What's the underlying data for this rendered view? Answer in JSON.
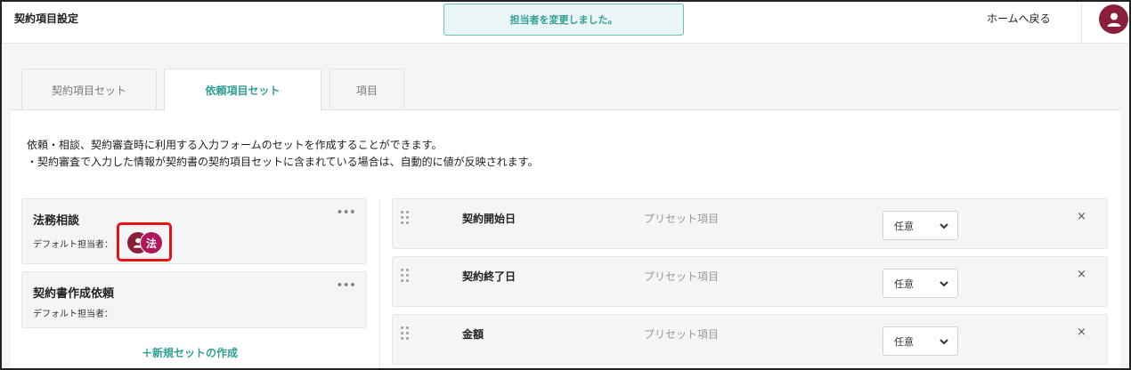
{
  "header": {
    "title": "契約項目設定",
    "toast": "担当者を変更しました。",
    "home_link": "ホームへ戻る",
    "avatar_icon": "user-icon"
  },
  "tabs": [
    {
      "label": "契約項目セット",
      "active": false
    },
    {
      "label": "依頼項目セット",
      "active": true
    },
    {
      "label": "項目",
      "active": false
    }
  ],
  "description": {
    "line1": "依頼・相談、契約審査時に利用する入力フォームのセットを作成することができます。",
    "line2": "・契約審査で入力した情報が契約書の契約項目セットに含まれている場合は、自動的に値が反映されます。"
  },
  "sets": [
    {
      "name": "法務相談",
      "owner_label": "デフォルト担当者：",
      "owner_badge": "法"
    },
    {
      "name": "契約書作成依頼",
      "owner_label": "デフォルト担当者："
    }
  ],
  "new_set_label": "＋新規セットの作成",
  "more_icon": "•••",
  "items": [
    {
      "name": "契約開始日",
      "type": "プリセット項目",
      "requirement": "任意"
    },
    {
      "name": "契約終了日",
      "type": "プリセット項目",
      "requirement": "任意"
    },
    {
      "name": "金額",
      "type": "プリセット項目",
      "requirement": "任意"
    }
  ],
  "remove_icon": "×",
  "colors": {
    "accent": "#2f9e93",
    "avatar": "#8a1f3c",
    "dept_badge": "#b0165a",
    "highlight": "#e51414"
  }
}
